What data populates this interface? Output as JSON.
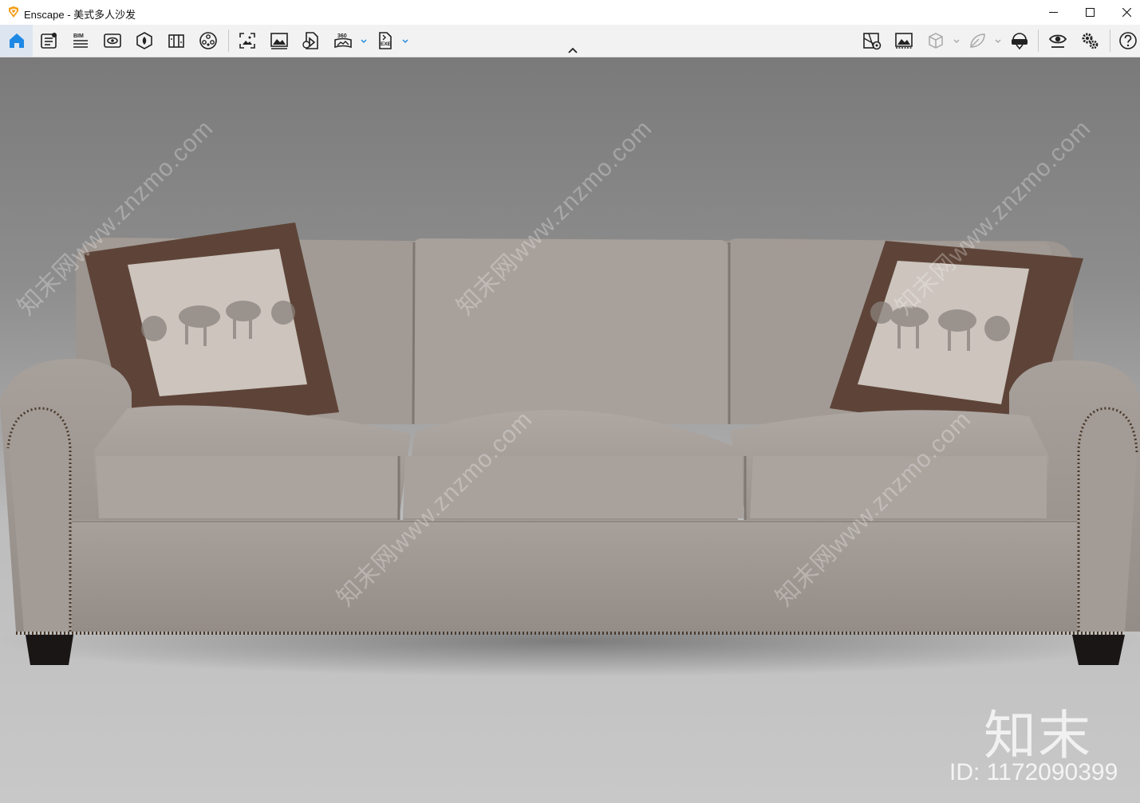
{
  "window": {
    "app_name": "Enscape",
    "separator": " - ",
    "document_title": "美式多人沙发",
    "controls": [
      "minimize",
      "maximize",
      "close"
    ]
  },
  "toolbar": {
    "left_icons": [
      "home-icon",
      "project-info-icon",
      "bim-icon",
      "views-icon",
      "asset-library-icon",
      "material-editor-icon",
      "object-library-icon",
      "screenshot-icon",
      "render-image-icon",
      "batch-render-icon",
      "panorama-360-icon",
      "export-exe-icon"
    ],
    "bim_label": "BIM",
    "panorama_label": "360",
    "exe_label": "EXE",
    "right_icons": [
      "map-settings-icon",
      "gallery-icon",
      "view-cube-icon",
      "sketch-mode-icon",
      "vr-headset-icon",
      "visual-settings-icon",
      "general-settings-icon",
      "help-icon"
    ]
  },
  "viewport": {
    "subject": "sofa-render",
    "watermark_text": "知末网www.znzmo.com",
    "brand_watermark": "知末",
    "id_watermark": "ID: 1172090399"
  },
  "colors": {
    "accent": "#1e88e5",
    "logo": "#f39c12",
    "toolbar_bg": "#f2f2f2",
    "background_top": "#7a7a7a",
    "floor": "#c8c8c8",
    "sofa_fabric": "#a39b96",
    "pillow_border": "#5e4438",
    "pillow_center": "#ccc4bd",
    "leg": "#1a1616"
  }
}
